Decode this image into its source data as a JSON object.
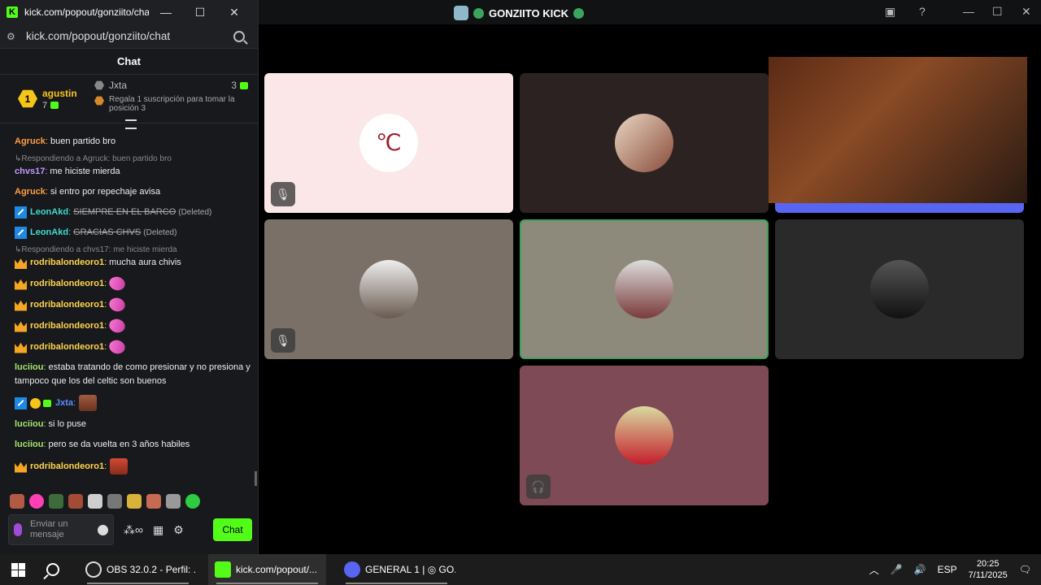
{
  "chat_window": {
    "title": "kick.com/popout/gonziito/cha...",
    "url": "kick.com/popout/gonziito/chat",
    "header": "Chat",
    "leaderboard": {
      "rank": "1",
      "top_user": "agustin",
      "top_count": "7",
      "next_user": "Jxta",
      "next_count": "3",
      "note": "Regala 1 suscripción para tomar la posición 3"
    },
    "messages": [
      {
        "user": "Agruck",
        "text": "buen partido bro"
      },
      {
        "reply": "Respondiendo a Agruck: buen partido bro"
      },
      {
        "user": "chvs17",
        "text": "me hiciste mierda"
      },
      {
        "user": "Agruck",
        "text": "si entro por repechaje avisa"
      },
      {
        "user": "LeonAkd",
        "deleted": "SIEMPRE EN EL BARCO",
        "tag": "(Deleted)"
      },
      {
        "user": "LeonAkd",
        "deleted": "GRACIAS CHVS",
        "tag": "(Deleted)"
      },
      {
        "reply": "Respondiendo a chvs17: me hiciste mierda"
      },
      {
        "user": "rodribalondeoro1",
        "text": "mucha aura chivis"
      },
      {
        "user": "rodribalondeoro1",
        "text": ""
      },
      {
        "user": "rodribalondeoro1",
        "text": ""
      },
      {
        "user": "rodribalondeoro1",
        "text": ""
      },
      {
        "user": "rodribalondeoro1",
        "text": ""
      },
      {
        "user": "luciiou",
        "text": "estaba tratando de como presionar y no presiona y tampoco que los del celtic son buenos"
      },
      {
        "user": "Jxta",
        "text": ""
      },
      {
        "user": "luciiou",
        "text": "si lo puse"
      },
      {
        "user": "luciiou",
        "text": "pero se da vuelta en 3 años habiles"
      },
      {
        "user": "rodribalondeoro1",
        "text": ""
      }
    ],
    "input_placeholder": "Enviar un mensaje",
    "send_label": "Chat"
  },
  "call_window": {
    "title": "GONZIITO KICK"
  },
  "taskbar": {
    "items": [
      {
        "label": "OBS 32.0.2 - Perfil: ..."
      },
      {
        "label": "kick.com/popout/..."
      },
      {
        "label": "GENERAL 1 | ◎ GO..."
      }
    ],
    "language": "ESP",
    "time": "20:25",
    "date": "7/11/2025"
  }
}
